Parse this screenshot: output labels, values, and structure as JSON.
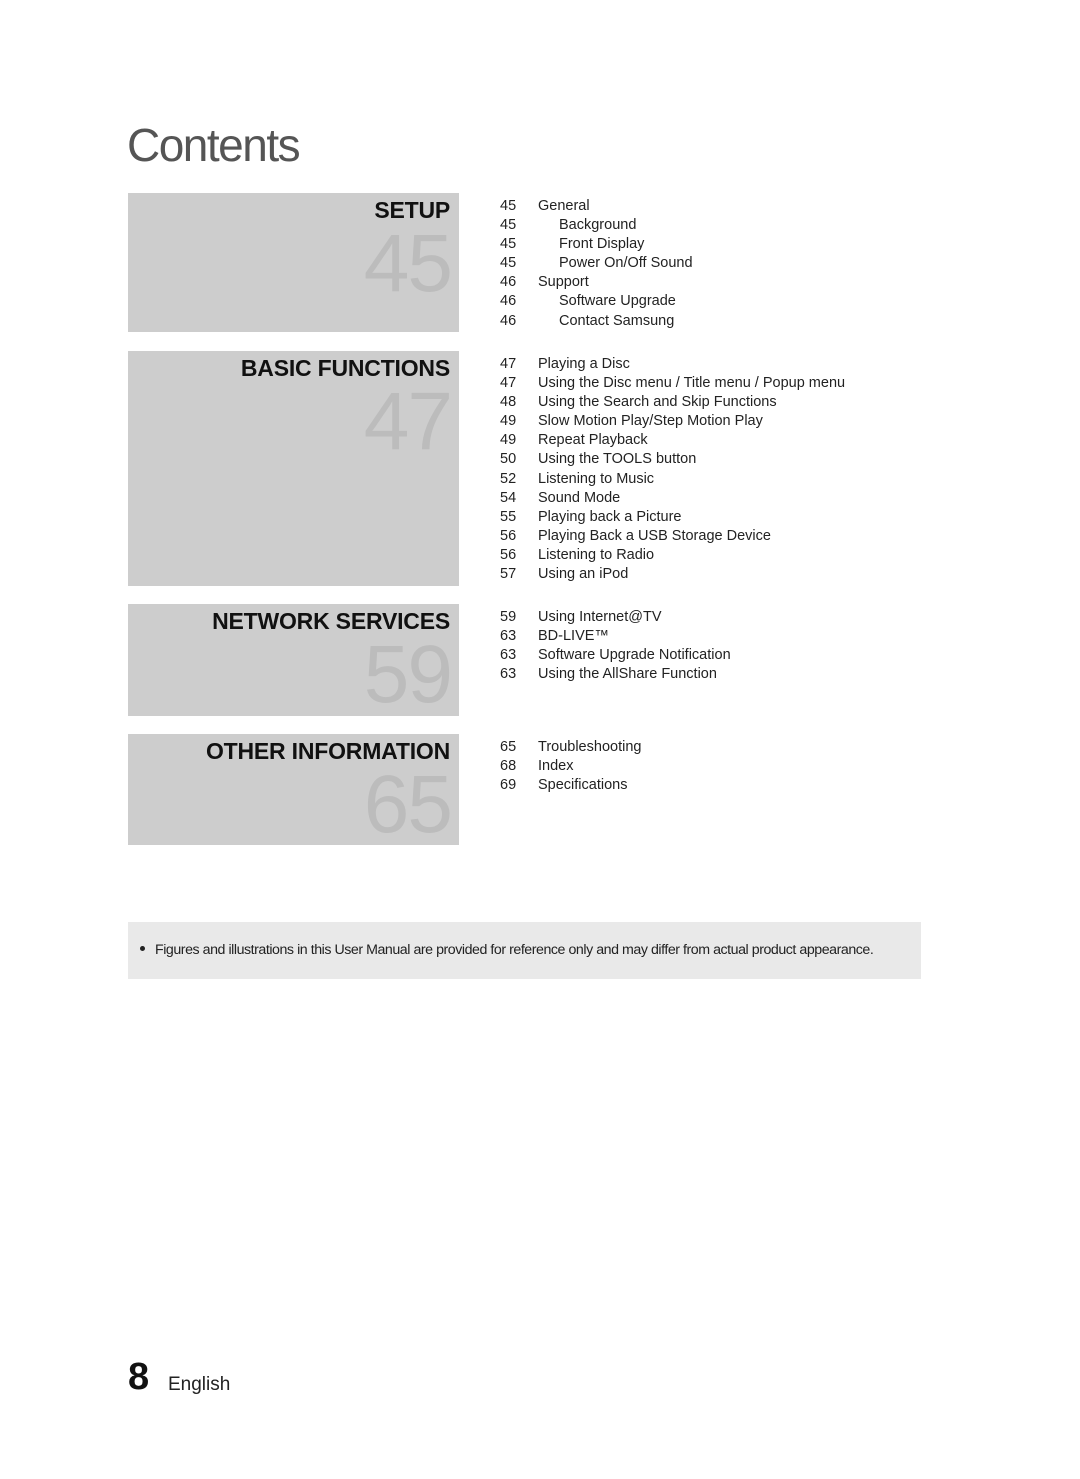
{
  "page_title": "Contents",
  "sections": [
    {
      "title": "SETUP",
      "start_page": "45",
      "entries": [
        {
          "page": "45",
          "text": "General",
          "sub": false
        },
        {
          "page": "45",
          "text": "Background",
          "sub": true
        },
        {
          "page": "45",
          "text": "Front Display",
          "sub": true
        },
        {
          "page": "45",
          "text": "Power On/Off Sound",
          "sub": true
        },
        {
          "page": "46",
          "text": "Support",
          "sub": false
        },
        {
          "page": "46",
          "text": "Software Upgrade",
          "sub": true
        },
        {
          "page": "46",
          "text": "Contact Samsung",
          "sub": true
        }
      ]
    },
    {
      "title": "BASIC FUNCTIONS",
      "start_page": "47",
      "entries": [
        {
          "page": "47",
          "text": "Playing a Disc",
          "sub": false
        },
        {
          "page": "47",
          "text": "Using the Disc menu / Title menu / Popup menu",
          "sub": false
        },
        {
          "page": "48",
          "text": "Using the Search and Skip Functions",
          "sub": false
        },
        {
          "page": "49",
          "text": "Slow Motion Play/Step Motion Play",
          "sub": false
        },
        {
          "page": "49",
          "text": "Repeat Playback",
          "sub": false
        },
        {
          "page": "50",
          "text": "Using the TOOLS button",
          "sub": false
        },
        {
          "page": "52",
          "text": "Listening to Music",
          "sub": false
        },
        {
          "page": "54",
          "text": "Sound Mode",
          "sub": false
        },
        {
          "page": "55",
          "text": "Playing back a Picture",
          "sub": false
        },
        {
          "page": "56",
          "text": "Playing Back a USB Storage Device",
          "sub": false
        },
        {
          "page": "56",
          "text": "Listening to Radio",
          "sub": false
        },
        {
          "page": "57",
          "text": "Using an iPod",
          "sub": false
        }
      ]
    },
    {
      "title": "NETWORK SERVICES",
      "start_page": "59",
      "entries": [
        {
          "page": "59",
          "text": "Using Internet@TV",
          "sub": false
        },
        {
          "page": "63",
          "text": "BD-LIVE™",
          "sub": false
        },
        {
          "page": "63",
          "text": "Software Upgrade Notification",
          "sub": false
        },
        {
          "page": "63",
          "text": "Using the AllShare Function",
          "sub": false
        }
      ]
    },
    {
      "title": "OTHER INFORMATION",
      "start_page": "65",
      "entries": [
        {
          "page": "65",
          "text": "Troubleshooting",
          "sub": false
        },
        {
          "page": "68",
          "text": "Index",
          "sub": false
        },
        {
          "page": "69",
          "text": "Specifications",
          "sub": false
        }
      ]
    }
  ],
  "note": "Figures and illustrations in this User Manual are provided for reference only and may differ from actual product appearance.",
  "footer": {
    "page_number": "8",
    "language": "English"
  }
}
